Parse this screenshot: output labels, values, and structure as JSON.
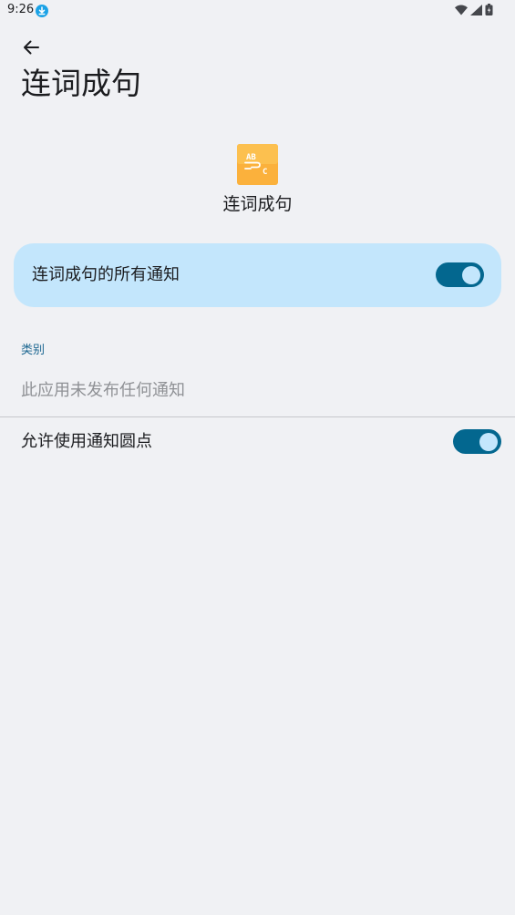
{
  "status_bar": {
    "time": "9:26"
  },
  "header": {
    "title": "连词成句"
  },
  "app": {
    "name": "连词成句",
    "icon": "abc-word-app-icon",
    "icon_color": "#fbb13c"
  },
  "master_toggle": {
    "label": "连词成句的所有通知",
    "enabled": true
  },
  "categories": {
    "header": "类别",
    "empty_message": "此应用未发布任何通知"
  },
  "notification_dots": {
    "label": "允许使用通知圆点",
    "enabled": true
  },
  "colors": {
    "accent": "#03678f",
    "card_bg": "#c3e6fc",
    "background": "#f0f1f4"
  }
}
